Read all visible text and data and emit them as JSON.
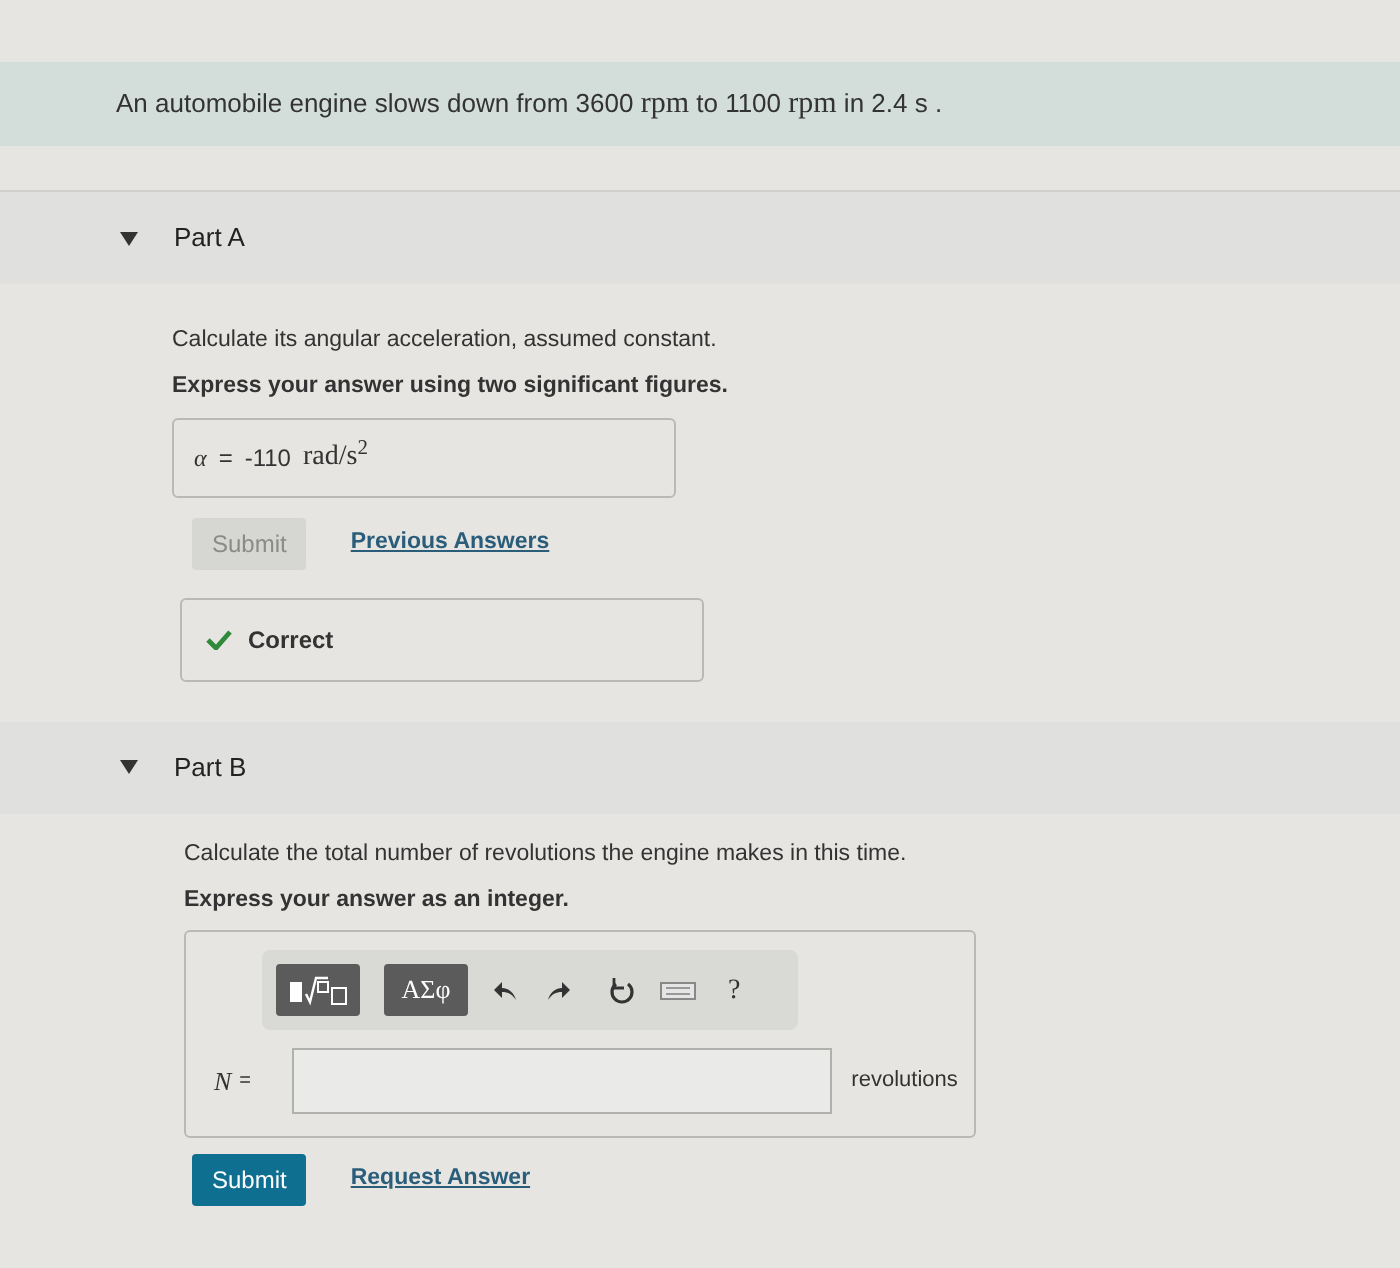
{
  "problem": {
    "segments": [
      {
        "kind": "plain",
        "text": "An automobile engine slows down from 3600 "
      },
      {
        "kind": "unit",
        "text": "rpm"
      },
      {
        "kind": "plain",
        "text": " to 1100 "
      },
      {
        "kind": "unit",
        "text": "rpm"
      },
      {
        "kind": "plain",
        "text": " in 2.4 s ."
      }
    ]
  },
  "parts": [
    {
      "label": "Part A",
      "expanded": true,
      "question": "Calculate its angular acceleration, assumed constant.",
      "instruction": "Express your answer using two significant figures.",
      "answer": {
        "kind": "given",
        "variable": "α",
        "equals": "=",
        "value": "-110",
        "unit": "rad/s$^{2}$"
      },
      "submit": {
        "label": "Submit",
        "disabled": true
      },
      "link": "Previous Answers",
      "feedback": {
        "kind": "correct",
        "text": "Correct"
      }
    },
    {
      "label": "Part B",
      "expanded": true,
      "question": "Calculate the total number of revolutions the engine makes in this time.",
      "instruction": "Express your answer as an integer.",
      "toolbar": {
        "symbols": "ΑΣφ",
        "help": "?"
      },
      "answer": {
        "kind": "entry",
        "variable": "N",
        "equals": "=",
        "unit": "revolutions"
      },
      "submit": {
        "label": "Submit",
        "disabled": false
      },
      "link": "Request Answer"
    }
  ]
}
